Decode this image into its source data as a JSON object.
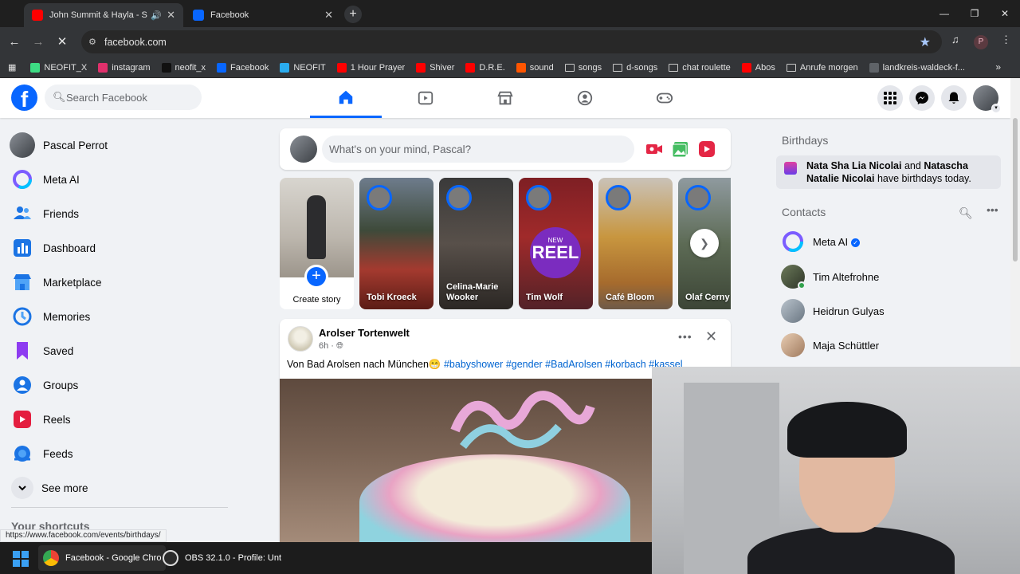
{
  "browser": {
    "tabs": [
      {
        "title": "John Summit & Hayla - Shi",
        "active": true
      },
      {
        "title": "Facebook",
        "active": false
      }
    ],
    "url": "facebook.com",
    "profile_initial": "P",
    "bookmarks": [
      {
        "label": "NEOFIT_X",
        "color": "#3ddc84",
        "kind": "site"
      },
      {
        "label": "instagram",
        "color": "#e1306c",
        "kind": "site"
      },
      {
        "label": "neofit_x",
        "color": "#111111",
        "kind": "site"
      },
      {
        "label": "Facebook",
        "color": "#0866ff",
        "kind": "site"
      },
      {
        "label": "NEOFIT",
        "color": "#2aabee",
        "kind": "site"
      },
      {
        "label": "1 Hour Prayer",
        "color": "#ff0000",
        "kind": "site"
      },
      {
        "label": "Shiver",
        "color": "#ff0000",
        "kind": "site"
      },
      {
        "label": "D.R.E.",
        "color": "#ff0000",
        "kind": "site"
      },
      {
        "label": "sound",
        "color": "#ff5500",
        "kind": "site"
      },
      {
        "label": "songs",
        "color": "",
        "kind": "folder"
      },
      {
        "label": "d-songs",
        "color": "",
        "kind": "folder"
      },
      {
        "label": "chat roulette",
        "color": "",
        "kind": "folder"
      },
      {
        "label": "Abos",
        "color": "#ff0000",
        "kind": "site"
      },
      {
        "label": "Anrufe morgen",
        "color": "",
        "kind": "folder"
      },
      {
        "label": "landkreis-waldeck-f...",
        "color": "",
        "kind": "site-globe"
      }
    ],
    "status_url": "https://www.facebook.com/events/birthdays/"
  },
  "facebook": {
    "logo": "f",
    "search_placeholder": "Search Facebook",
    "brand_color": "#0866ff",
    "sidebar": [
      {
        "label": "Pascal Perrot",
        "icon": "profile-avatar"
      },
      {
        "label": "Meta AI",
        "icon": "meta-ai-icon"
      },
      {
        "label": "Friends",
        "icon": "friends-icon"
      },
      {
        "label": "Dashboard",
        "icon": "dashboard-icon"
      },
      {
        "label": "Marketplace",
        "icon": "marketplace-icon"
      },
      {
        "label": "Memories",
        "icon": "memories-icon"
      },
      {
        "label": "Saved",
        "icon": "saved-icon"
      },
      {
        "label": "Groups",
        "icon": "groups-icon"
      },
      {
        "label": "Reels",
        "icon": "reels-icon"
      },
      {
        "label": "Feeds",
        "icon": "feeds-icon"
      },
      {
        "label": "See more",
        "icon": "chevron-down-icon"
      }
    ],
    "shortcuts_heading": "Your shortcuts",
    "composer_placeholder": "What's on your mind, Pascal?",
    "stories": {
      "create_label": "Create story",
      "items": [
        "Tobi Kroeck",
        "Celina-Marie Wooker",
        "Tim Wolf",
        "Café Bloom",
        "Olaf Cerny"
      ],
      "reel_new": "NEW",
      "reel_label": "REEL"
    },
    "post": {
      "author": "Arolser Tortenwelt",
      "time": "6h",
      "text": "Von Bad Arolsen nach München😁",
      "hashtags": [
        "#babyshower",
        "#gender",
        "#BadArolsen",
        "#korbach",
        "#kassel"
      ]
    },
    "right": {
      "birthdays_heading": "Birthdays",
      "birthday_name_1": "Nata Sha Lia Nicolai",
      "birthday_and": "and",
      "birthday_name_2": "Natascha Natalie Nicolai",
      "birthday_suffix": "have birthdays today.",
      "contacts_heading": "Contacts",
      "contacts": [
        {
          "name": "Meta AI",
          "verified": true,
          "online": false
        },
        {
          "name": "Tim Altefrohne",
          "verified": false,
          "online": true
        },
        {
          "name": "Heidrun Gulyas",
          "verified": false,
          "online": false
        },
        {
          "name": "Maja Schüttler",
          "verified": false,
          "online": false
        }
      ]
    }
  },
  "taskbar": {
    "items": [
      {
        "label": "Facebook - Google Chro",
        "icon": "chrome-icon"
      },
      {
        "label": "OBS 32.1.0 - Profile: Unt",
        "icon": "obs-icon"
      }
    ]
  }
}
